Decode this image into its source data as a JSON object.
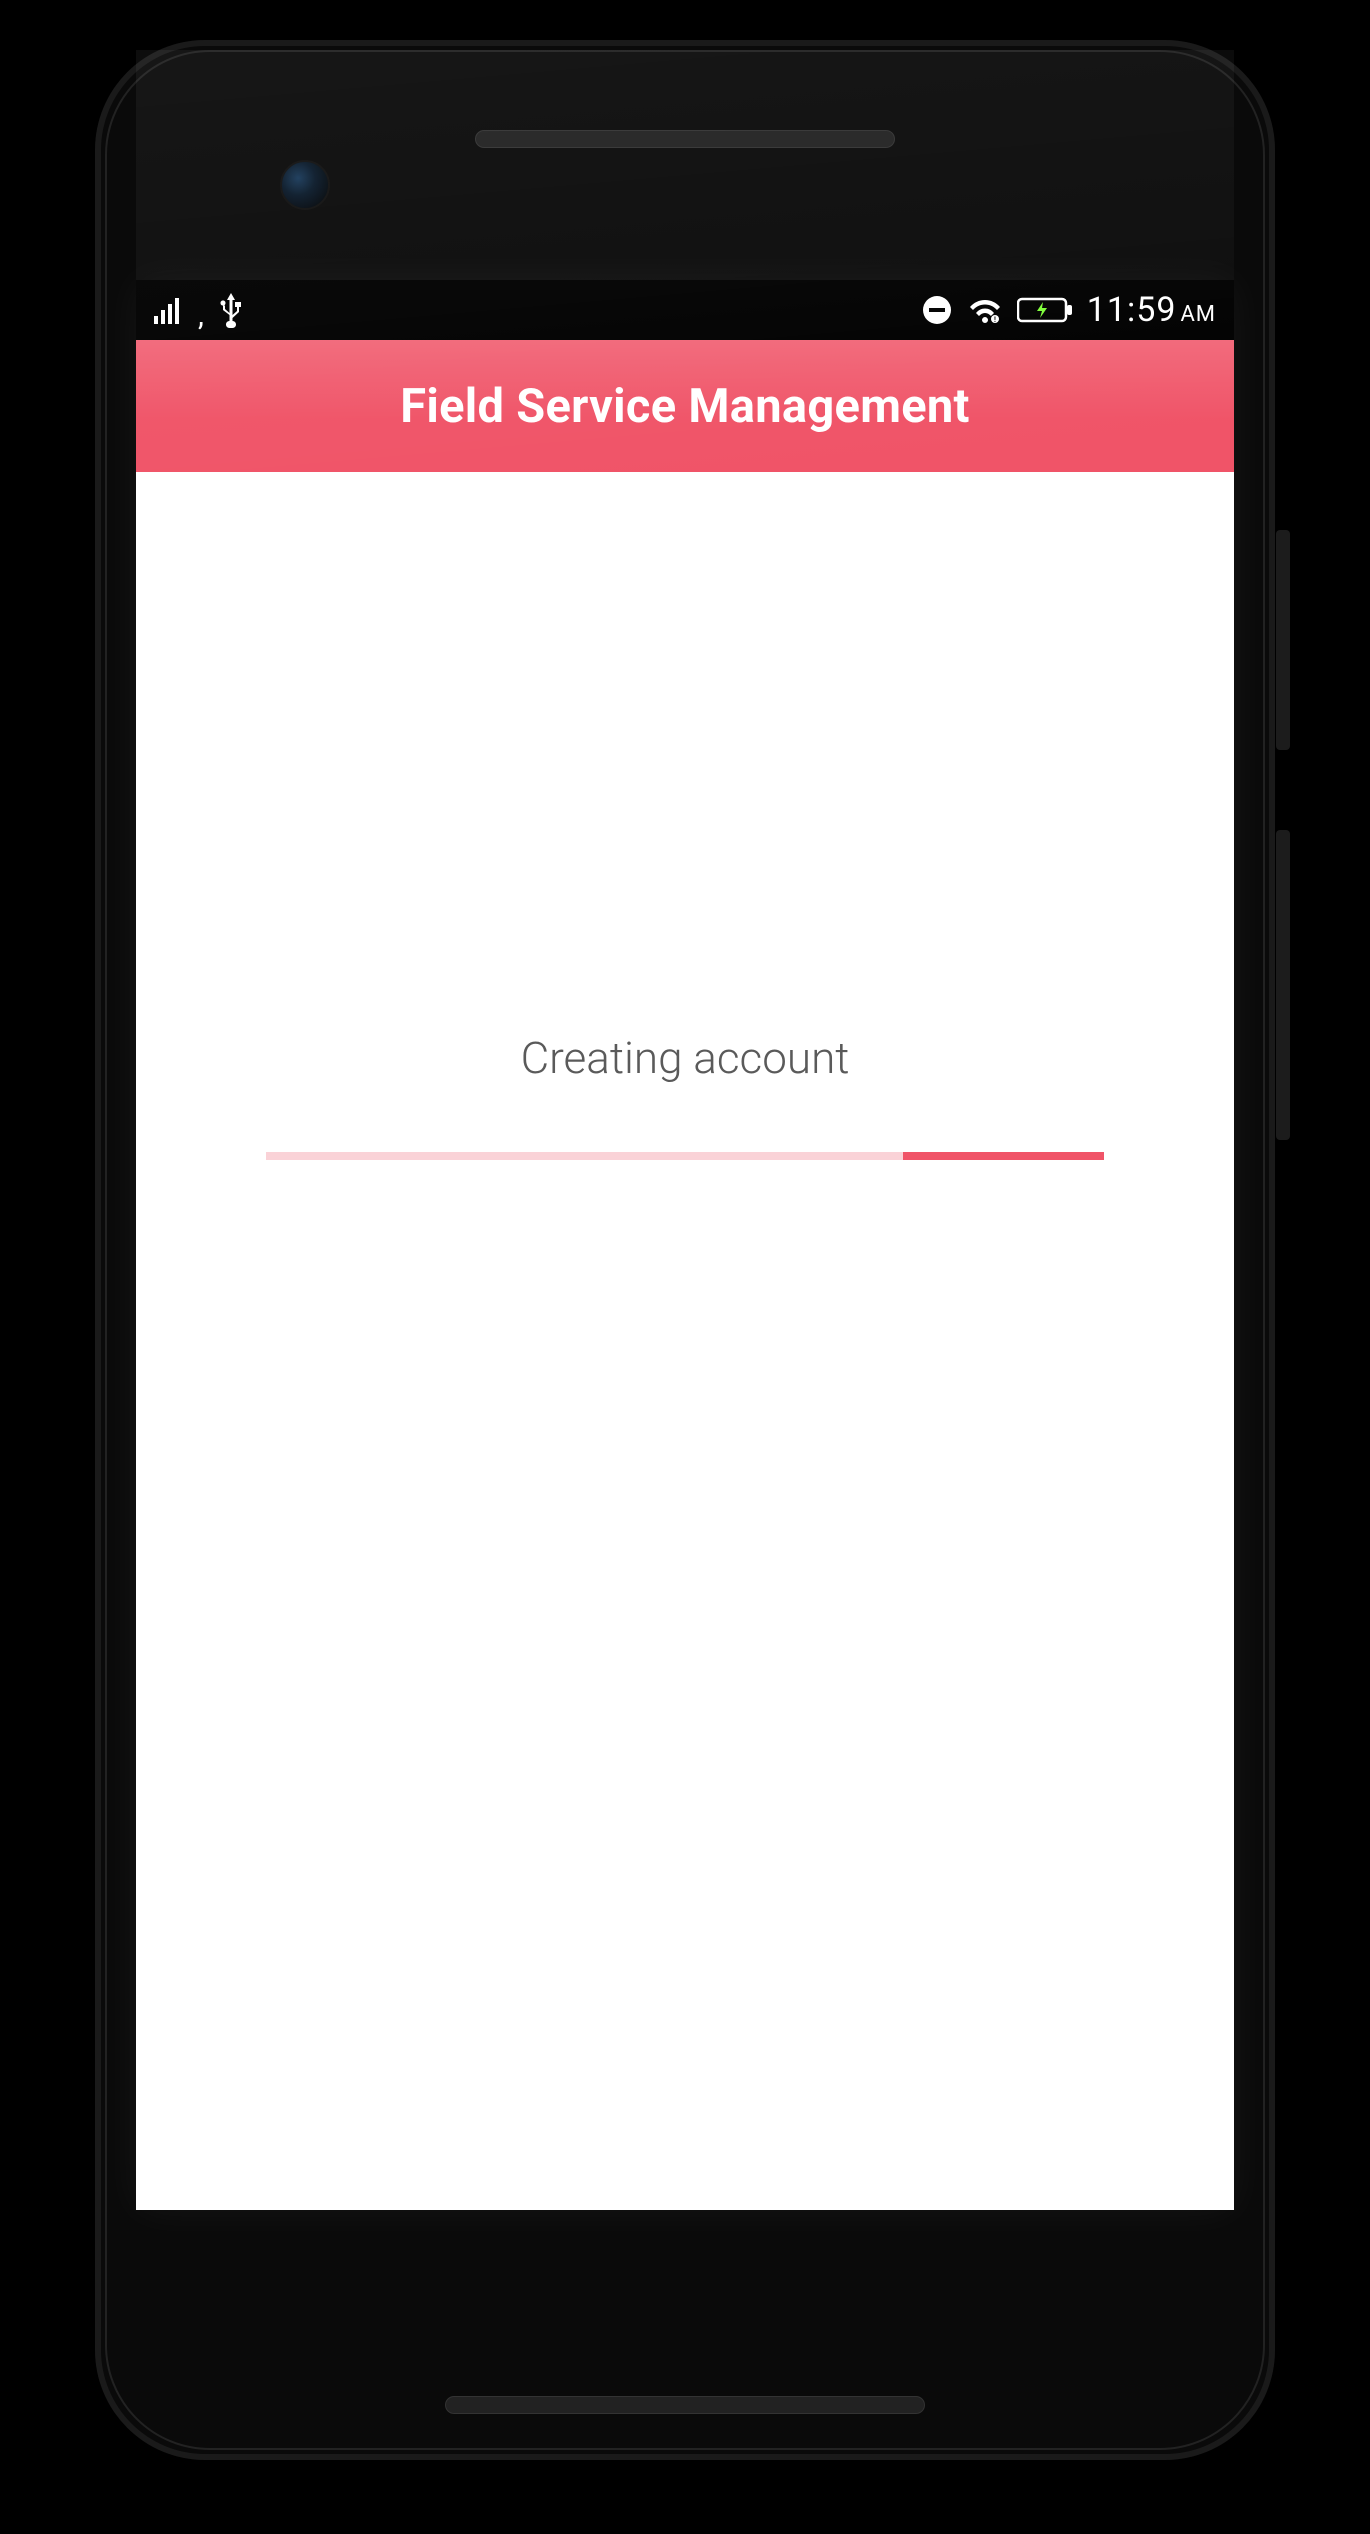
{
  "status_bar": {
    "time": "11:59",
    "ampm": "AM",
    "icons": {
      "signal": "signal-icon",
      "usb": "usb-icon",
      "dnd": "do-not-disturb-icon",
      "wifi": "wifi-icon",
      "battery": "battery-charging-icon"
    }
  },
  "app_bar": {
    "title": "Field Service Management",
    "color": "#f05468"
  },
  "loading": {
    "message": "Creating account"
  }
}
